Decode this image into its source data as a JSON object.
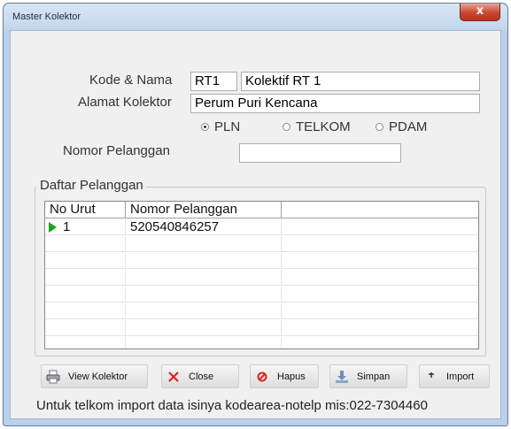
{
  "window": {
    "title": "Master Kolektor",
    "close_glyph": "x"
  },
  "form": {
    "kode_nama_label": "Kode & Nama",
    "kode_value": "RT1",
    "nama_value": "Kolektif RT 1",
    "alamat_label": "Alamat Kolektor",
    "alamat_value": "Perum Puri Kencana",
    "radio_options": [
      {
        "label": "PLN",
        "selected": true
      },
      {
        "label": "TELKOM",
        "selected": false
      },
      {
        "label": "PDAM",
        "selected": false
      }
    ],
    "nomor_pelanggan_label": "Nomor Pelanggan",
    "nomor_pelanggan_value": ""
  },
  "daftar": {
    "group_title": "Daftar Pelanggan",
    "columns": [
      "No Urut",
      "Nomor Pelanggan"
    ],
    "rows": [
      {
        "no_urut": "1",
        "nomor_pelanggan": "520540846257",
        "current": true
      }
    ]
  },
  "buttons": {
    "view_kolektor": "View Kolektor",
    "close": "Close",
    "hapus": "Hapus",
    "simpan": "Simpan",
    "import": "Import"
  },
  "icons": {
    "view_kolektor": "printer-icon",
    "close": "x-icon",
    "hapus": "delete-icon",
    "simpan": "save-icon",
    "import": "import-icon"
  },
  "footer_text": "Untuk telkom import data isinya kodearea-notelp mis:022-7304460"
}
